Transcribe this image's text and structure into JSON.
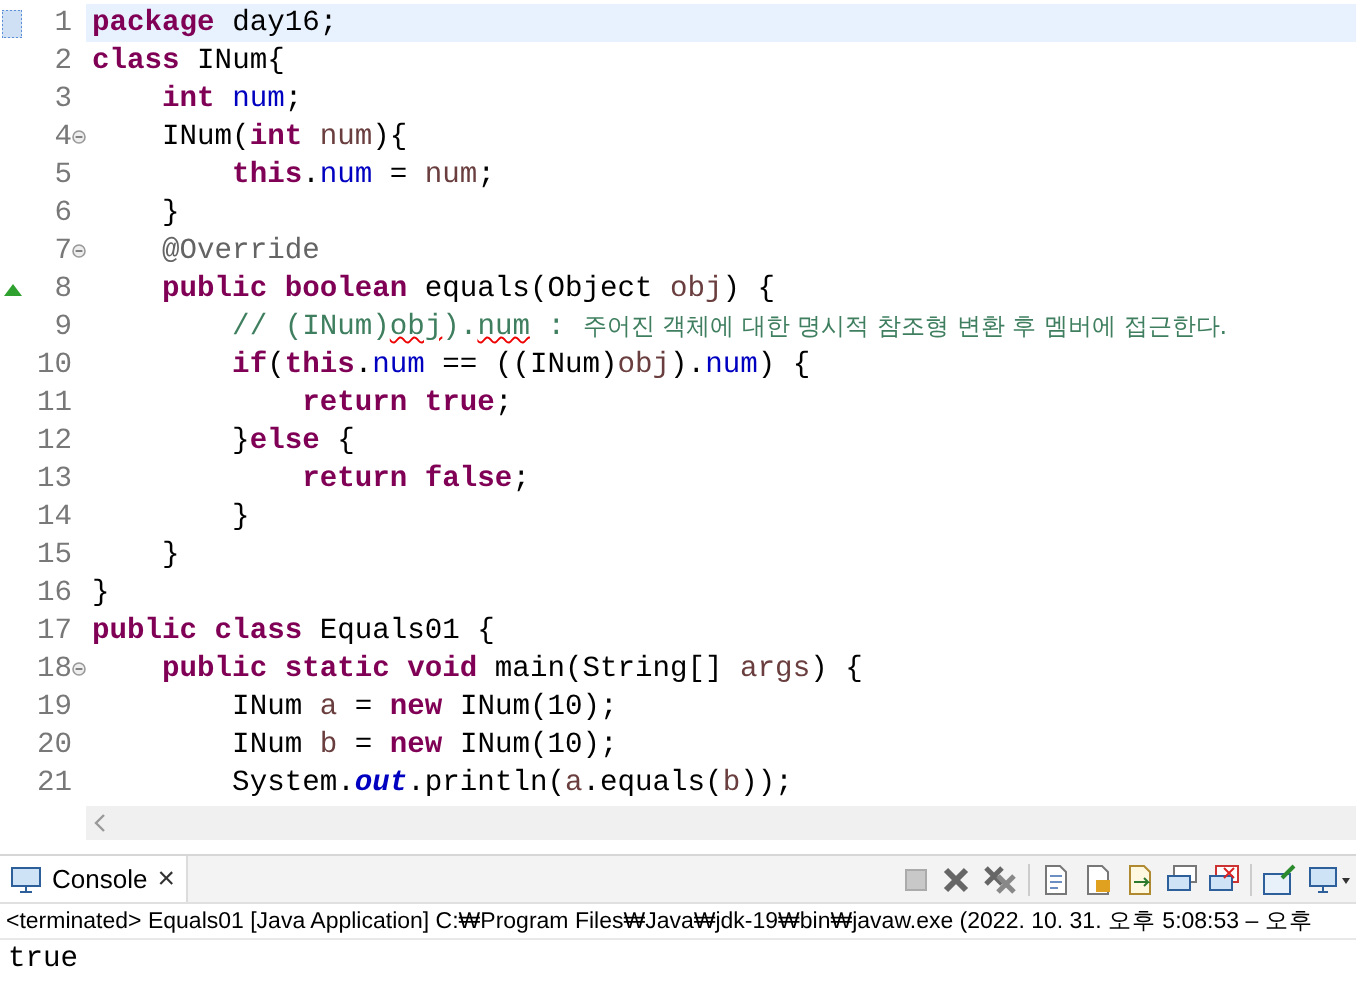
{
  "editor": {
    "lines": [
      {
        "number": "1",
        "current": true,
        "fold_button": false,
        "override_mark": false,
        "tokens": [
          {
            "kind": "kw",
            "text": "package"
          },
          {
            "kind": "plain",
            "text": " day16;"
          }
        ]
      },
      {
        "number": "2",
        "current": false,
        "fold_button": false,
        "override_mark": false,
        "tokens": [
          {
            "kind": "kw",
            "text": "class"
          },
          {
            "kind": "plain",
            "text": " INum{"
          }
        ]
      },
      {
        "number": "3",
        "current": false,
        "fold_button": false,
        "override_mark": false,
        "tokens": [
          {
            "kind": "kw",
            "text": "    int "
          },
          {
            "kind": "field",
            "text": "num"
          },
          {
            "kind": "plain",
            "text": ";"
          }
        ]
      },
      {
        "number": "4",
        "current": false,
        "fold_button": true,
        "override_mark": false,
        "tokens": [
          {
            "kind": "plain",
            "text": "    INum("
          },
          {
            "kind": "kw",
            "text": "int "
          },
          {
            "kind": "local",
            "text": "num"
          },
          {
            "kind": "plain",
            "text": "){"
          }
        ]
      },
      {
        "number": "5",
        "current": false,
        "fold_button": false,
        "override_mark": false,
        "tokens": [
          {
            "kind": "kw",
            "text": "        this"
          },
          {
            "kind": "plain",
            "text": "."
          },
          {
            "kind": "field",
            "text": "num"
          },
          {
            "kind": "plain",
            "text": " = "
          },
          {
            "kind": "local",
            "text": "num"
          },
          {
            "kind": "plain",
            "text": ";"
          }
        ]
      },
      {
        "number": "6",
        "current": false,
        "fold_button": false,
        "override_mark": false,
        "tokens": [
          {
            "kind": "plain",
            "text": "    }"
          }
        ]
      },
      {
        "number": "7",
        "current": false,
        "fold_button": true,
        "override_mark": false,
        "tokens": [
          {
            "kind": "annotation",
            "text": "    @Override"
          }
        ]
      },
      {
        "number": "8",
        "current": false,
        "fold_button": false,
        "override_mark": true,
        "tokens": [
          {
            "kind": "kw",
            "text": "    public boolean"
          },
          {
            "kind": "plain",
            "text": " equals(Object "
          },
          {
            "kind": "local",
            "text": "obj"
          },
          {
            "kind": "plain",
            "text": ") {"
          }
        ]
      },
      {
        "number": "9",
        "current": false,
        "fold_button": false,
        "override_mark": false,
        "tokens": [
          {
            "kind": "comment",
            "text": "        // (INum)"
          },
          {
            "kind": "comment_misspelled",
            "text": "obj"
          },
          {
            "kind": "comment",
            "text": ")."
          },
          {
            "kind": "comment_misspelled",
            "text": "num"
          },
          {
            "kind": "comment",
            "text": " : "
          },
          {
            "kind": "comment_hangul",
            "text": "주어진 객체에 대한 명시적 참조형 변환 후 멤버에 접근한다."
          }
        ]
      },
      {
        "number": "10",
        "current": false,
        "fold_button": false,
        "override_mark": false,
        "tokens": [
          {
            "kind": "kw",
            "text": "        if"
          },
          {
            "kind": "plain",
            "text": "("
          },
          {
            "kind": "kw",
            "text": "this"
          },
          {
            "kind": "plain",
            "text": "."
          },
          {
            "kind": "field",
            "text": "num"
          },
          {
            "kind": "plain",
            "text": " == ((INum)"
          },
          {
            "kind": "local",
            "text": "obj"
          },
          {
            "kind": "plain",
            "text": ")."
          },
          {
            "kind": "field",
            "text": "num"
          },
          {
            "kind": "plain",
            "text": ") {"
          }
        ]
      },
      {
        "number": "11",
        "current": false,
        "fold_button": false,
        "override_mark": false,
        "tokens": [
          {
            "kind": "kw",
            "text": "            return true"
          },
          {
            "kind": "plain",
            "text": ";"
          }
        ]
      },
      {
        "number": "12",
        "current": false,
        "fold_button": false,
        "override_mark": false,
        "tokens": [
          {
            "kind": "plain",
            "text": "        }"
          },
          {
            "kind": "kw",
            "text": "else"
          },
          {
            "kind": "plain",
            "text": " {"
          }
        ]
      },
      {
        "number": "13",
        "current": false,
        "fold_button": false,
        "override_mark": false,
        "tokens": [
          {
            "kind": "kw",
            "text": "            return false"
          },
          {
            "kind": "plain",
            "text": ";"
          }
        ]
      },
      {
        "number": "14",
        "current": false,
        "fold_button": false,
        "override_mark": false,
        "tokens": [
          {
            "kind": "plain",
            "text": "        }"
          }
        ]
      },
      {
        "number": "15",
        "current": false,
        "fold_button": false,
        "override_mark": false,
        "tokens": [
          {
            "kind": "plain",
            "text": "    }"
          }
        ]
      },
      {
        "number": "16",
        "current": false,
        "fold_button": false,
        "override_mark": false,
        "tokens": [
          {
            "kind": "plain",
            "text": "}"
          }
        ]
      },
      {
        "number": "17",
        "current": false,
        "fold_button": false,
        "override_mark": false,
        "tokens": [
          {
            "kind": "kw",
            "text": "public class"
          },
          {
            "kind": "plain",
            "text": " Equals01 {"
          }
        ]
      },
      {
        "number": "18",
        "current": false,
        "fold_button": true,
        "override_mark": false,
        "tokens": [
          {
            "kind": "kw",
            "text": "    public static void"
          },
          {
            "kind": "plain",
            "text": " main(String[] "
          },
          {
            "kind": "local",
            "text": "args"
          },
          {
            "kind": "plain",
            "text": ") {"
          }
        ]
      },
      {
        "number": "19",
        "current": false,
        "fold_button": false,
        "override_mark": false,
        "tokens": [
          {
            "kind": "plain",
            "text": "        INum "
          },
          {
            "kind": "local",
            "text": "a"
          },
          {
            "kind": "plain",
            "text": " = "
          },
          {
            "kind": "kw",
            "text": "new"
          },
          {
            "kind": "plain",
            "text": " INum(10);"
          }
        ]
      },
      {
        "number": "20",
        "current": false,
        "fold_button": false,
        "override_mark": false,
        "tokens": [
          {
            "kind": "plain",
            "text": "        INum "
          },
          {
            "kind": "local",
            "text": "b"
          },
          {
            "kind": "plain",
            "text": " = "
          },
          {
            "kind": "kw",
            "text": "new"
          },
          {
            "kind": "plain",
            "text": " INum(10);"
          }
        ]
      },
      {
        "number": "21",
        "current": false,
        "fold_button": false,
        "override_mark": false,
        "tokens": [
          {
            "kind": "plain",
            "text": "        System."
          },
          {
            "kind": "static_field",
            "text": "out"
          },
          {
            "kind": "plain",
            "text": ".println("
          },
          {
            "kind": "local",
            "text": "a"
          },
          {
            "kind": "plain",
            "text": ".equals("
          },
          {
            "kind": "local",
            "text": "b"
          },
          {
            "kind": "plain",
            "text": "));"
          }
        ]
      }
    ]
  },
  "console": {
    "tab": {
      "label": "Console",
      "close": "×",
      "selected": true
    },
    "status": "<terminated> Equals01 [Java Application] C:₩Program Files₩Java₩jdk-19₩bin₩javaw.exe  (2022. 10. 31. 오후 5:08:53 – 오후",
    "output": "true"
  }
}
